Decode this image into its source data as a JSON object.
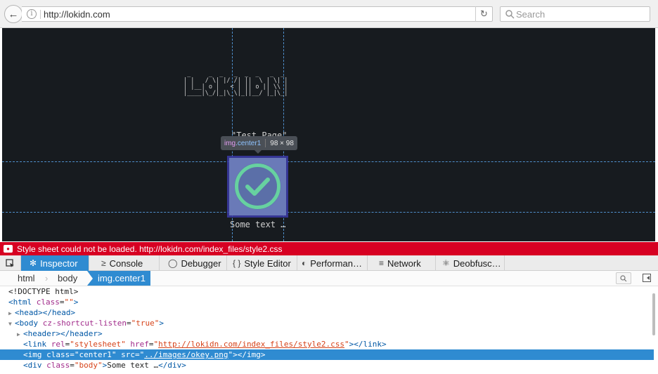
{
  "browser": {
    "url": "http://lokidn.com",
    "search_placeholder": "Search"
  },
  "page": {
    "ascii_logo": " _     _  _   _  _  _   _  _ \n| |   / \\| |/ /| ||  \\ | \\| |\n| |__| o |   < | || o || \\\\ |\n|____|\\_/|_|\\_\\|_||__/ |_|\\_|",
    "test_page_text": "\"Test Page\"",
    "some_text": "Some text …"
  },
  "tooltip": {
    "tag": "img",
    "class_name": ".center1",
    "dimensions": "98 × 98"
  },
  "error_bar": {
    "message": "Style sheet could not be loaded. http://lokidn.com/index_files/style2.css"
  },
  "devtools": {
    "tabs": [
      {
        "label": "Inspector",
        "icon": "inspector-icon"
      },
      {
        "label": "Console",
        "icon": "console-icon"
      },
      {
        "label": "Debugger",
        "icon": "debugger-icon"
      },
      {
        "label": "Style Editor",
        "icon": "style-editor-icon"
      },
      {
        "label": "Performan…",
        "icon": "performance-icon"
      },
      {
        "label": "Network",
        "icon": "network-icon"
      },
      {
        "label": "Deobfusc…",
        "icon": "deobfuscator-icon"
      }
    ],
    "active_tab": "Inspector",
    "breadcrumbs": [
      "html",
      "body",
      "img.center1"
    ]
  },
  "markup": {
    "doctype": "<!DOCTYPE html>",
    "html_class": "",
    "body_attr_name": "cz-shortcut-listen",
    "body_attr_value": "true",
    "link_rel": "stylesheet",
    "link_href": "http://lokidn.com/index_files/style2.css",
    "img_class": "center1",
    "img_src": "../images/okey.png",
    "div_class": "body",
    "div_text": "Some text …"
  },
  "colors": {
    "accent": "#2f8bd1",
    "error": "#d70022",
    "page_bg": "#171b1f",
    "check_green": "#67d1a0"
  }
}
